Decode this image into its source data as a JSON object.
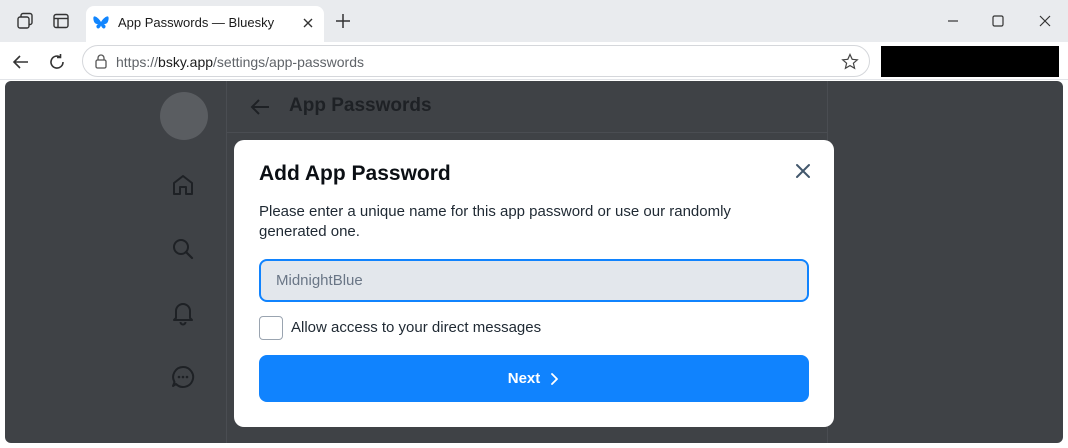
{
  "browser": {
    "tab_title": "App Passwords — Bluesky",
    "url_prefix": "https://",
    "url_host": "bsky.app",
    "url_path": "/settings/app-passwords"
  },
  "page": {
    "title": "App Passwords"
  },
  "modal": {
    "title": "Add App Password",
    "description": "Please enter a unique name for this app password or use our randomly generated one.",
    "name_input_value": "MidnightBlue",
    "checkbox_label": "Allow access to your direct messages",
    "checkbox_checked": false,
    "next_label": "Next"
  },
  "colors": {
    "accent": "#1083fe",
    "overlay": "#3f4246"
  }
}
